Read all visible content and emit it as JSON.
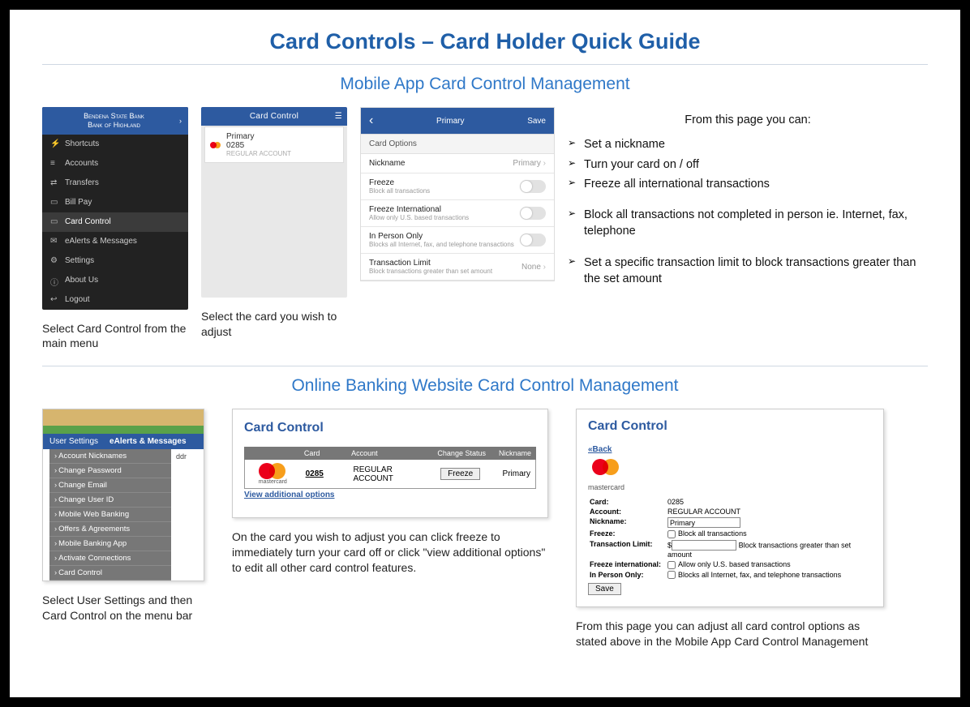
{
  "title": "Card Controls – Card Holder Quick Guide",
  "section_mobile": {
    "heading": "Mobile App Card Control Management",
    "phone1": {
      "bank_line1": "Bendena State Bank",
      "bank_line2": "Bank of Highland",
      "menu": [
        "Shortcuts",
        "Accounts",
        "Transfers",
        "Bill Pay",
        "Card Control",
        "eAlerts & Messages",
        "Settings",
        "About Us",
        "Logout"
      ],
      "caption": "Select Card Control from the main menu"
    },
    "phone2": {
      "header": "Card Control",
      "card_name": "Primary",
      "card_last4": "0285",
      "card_type": "REGULAR ACCOUNT",
      "caption": "Select the card you wish to adjust"
    },
    "phone3": {
      "back": "‹",
      "title": "Primary",
      "save": "Save",
      "section_label": "Card Options",
      "nickname_label": "Nickname",
      "nickname_value": "Primary",
      "freeze_label": "Freeze",
      "freeze_sub": "Block all transactions",
      "freeze_intl_label": "Freeze International",
      "freeze_intl_sub": "Allow only U.S. based transactions",
      "inperson_label": "In Person Only",
      "inperson_sub": "Blocks all Internet, fax, and telephone transactions",
      "txlimit_label": "Transaction Limit",
      "txlimit_sub": "Block transactions greater than set amount",
      "txlimit_value": "None"
    },
    "bullets": {
      "intro": "From this page you can:",
      "items": [
        "Set a nickname",
        "Turn your card on / off",
        "Freeze all international transactions",
        "Block all transactions not completed in person ie. Internet, fax, telephone",
        "Set a specific transaction limit to block transactions greater than the set amount"
      ]
    }
  },
  "section_web": {
    "heading": "Online Banking Website Card Control Management",
    "sshot1": {
      "nav1": "User Settings",
      "nav2": "eAlerts & Messages",
      "menu": [
        "Account Nicknames",
        "Change Password",
        "Change Email",
        "Change User ID",
        "Mobile Web Banking",
        "Offers & Agreements",
        "Mobile Banking App",
        "Activate Connections",
        "Card Control"
      ],
      "sidetxt": "ddr",
      "caption": "Select User Settings and then Card Control on the menu bar"
    },
    "sshot2": {
      "title": "Card Control",
      "th_card": "Card",
      "th_account": "Account",
      "th_status": "Change Status",
      "th_nick": "Nickname",
      "mc_text": "mastercard",
      "row_card": "0285",
      "row_account": "REGULAR ACCOUNT",
      "row_btn": "Freeze",
      "row_nick": "Primary",
      "viewadd": "View additional options",
      "caption": "On the card you wish to adjust you can click freeze to immediately turn your card off or click \"view additional options\" to edit all other card control features."
    },
    "sshot3": {
      "title": "Card Control",
      "back": "«Back",
      "mc_text": "mastercard",
      "card_lbl": "Card:",
      "card_val": "0285",
      "acct_lbl": "Account:",
      "acct_val": "REGULAR ACCOUNT",
      "nick_lbl": "Nickname:",
      "nick_val": "Primary",
      "freeze_lbl": "Freeze:",
      "freeze_cb": "Block all transactions",
      "tx_lbl": "Transaction Limit:",
      "tx_prefix": "$",
      "tx_note": "Block transactions greater than set amount",
      "intl_lbl": "Freeze international:",
      "intl_cb": "Allow only U.S. based transactions",
      "ip_lbl": "In Person Only:",
      "ip_cb": "Blocks all Internet, fax, and telephone transactions",
      "save": "Save",
      "caption": "From this page you can adjust all card control options as stated above in the Mobile App Card Control Management"
    }
  }
}
